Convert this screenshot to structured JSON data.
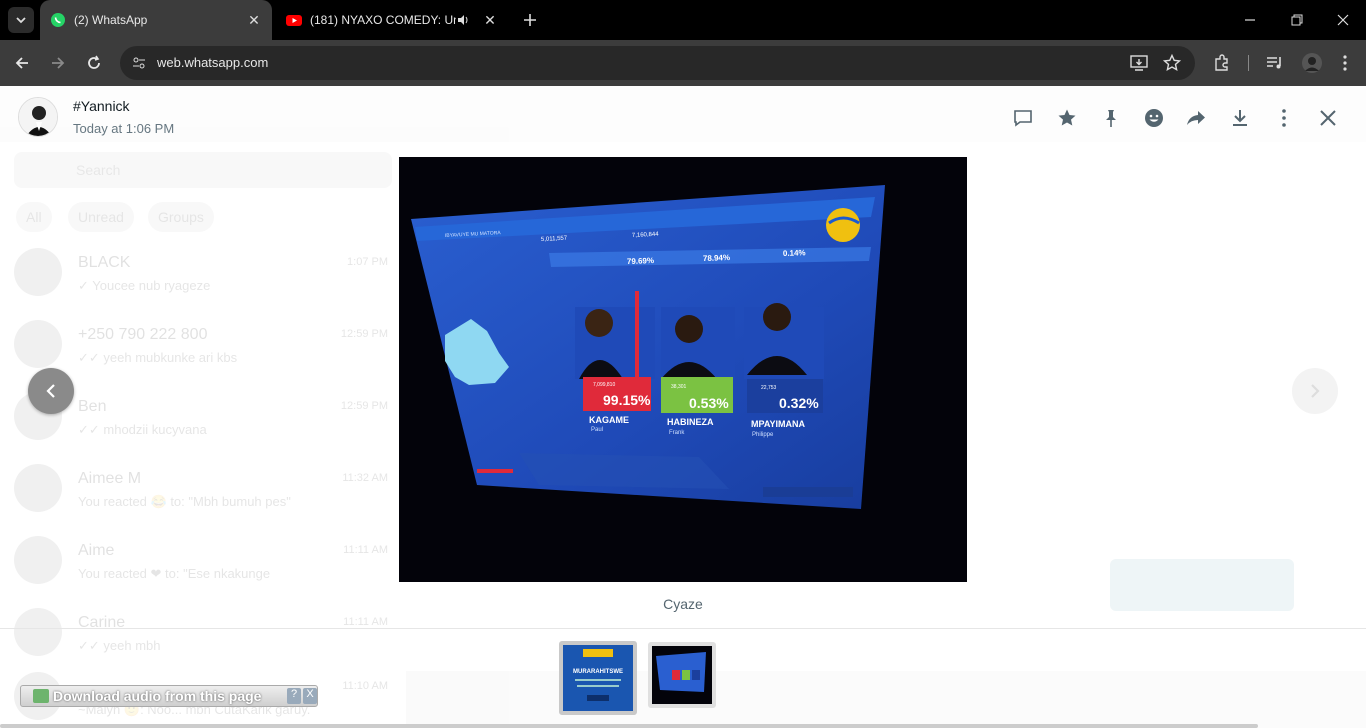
{
  "browser": {
    "tabs": [
      {
        "label": "(2) WhatsApp",
        "active": true,
        "favicon": "whatsapp-icon",
        "color": "#25d366"
      },
      {
        "label": "(181) NYAXO COMEDY: Um",
        "active": false,
        "favicon": "youtube-icon",
        "color": "#ff0000"
      }
    ],
    "url": "web.whatsapp.com"
  },
  "background_chat": {
    "search_placeholder": "Search",
    "filters": [
      "All",
      "Unread",
      "Groups"
    ],
    "chats": [
      {
        "name": "BLACK",
        "time": "1:07 PM",
        "preview": "✓ Youcee nub ryageze"
      },
      {
        "name": "+250 790 222 800",
        "time": "12:59 PM",
        "preview": "✓✓ yeeh mubkunke ari kbs"
      },
      {
        "name": "Ben",
        "time": "12:59 PM",
        "preview": "✓✓ mhodzii kucyvana"
      },
      {
        "name": "Aimee M",
        "time": "11:32 AM",
        "preview": "You reacted 😂 to: \"Mbh bumuh pes\""
      },
      {
        "name": "Aime",
        "time": "11:11 AM",
        "preview": "You reacted ❤ to: \"Ese nkakunge"
      },
      {
        "name": "Carine",
        "time": "11:11 AM",
        "preview": "✓✓ yeeh mbh"
      },
      {
        "name": "",
        "time": "11:10 AM",
        "preview": "~Malyn 🙂: Noo... mbh CutaKarik garuy."
      }
    ]
  },
  "viewer": {
    "sender_name": "#Yannick",
    "sent_time": "Today at 1:06 PM",
    "caption": "Cyaze",
    "actions": [
      "reply-icon",
      "star-icon",
      "pin-icon",
      "react-icon",
      "forward-icon",
      "download-icon",
      "menu-icon",
      "close-icon"
    ],
    "photo": {
      "stat1": "5,011,557",
      "stat2": "7,160,844",
      "pct_a": "79.69%",
      "pct_b": "78.94%",
      "pct_c": "0.14%",
      "candidates": [
        {
          "surname": "KAGAME",
          "first": "Paul",
          "votes": "7,099,810",
          "percent": "99.15%",
          "color": "#e02a3a"
        },
        {
          "surname": "HABINEZA",
          "first": "Frank",
          "votes": "38,301",
          "percent": "0.53%",
          "color": "#7bc242"
        },
        {
          "surname": "MPAYIMANA",
          "first": "Philippe",
          "votes": "22,753",
          "percent": "0.32%",
          "color": "#1b3f9e"
        }
      ]
    },
    "thumbnails": [
      {
        "title": "MURARAHITSWE",
        "selected": false
      },
      {
        "title": "",
        "selected": true
      }
    ]
  },
  "extension_bar": {
    "label": "Download audio from this page",
    "help": "?",
    "close": "X"
  }
}
